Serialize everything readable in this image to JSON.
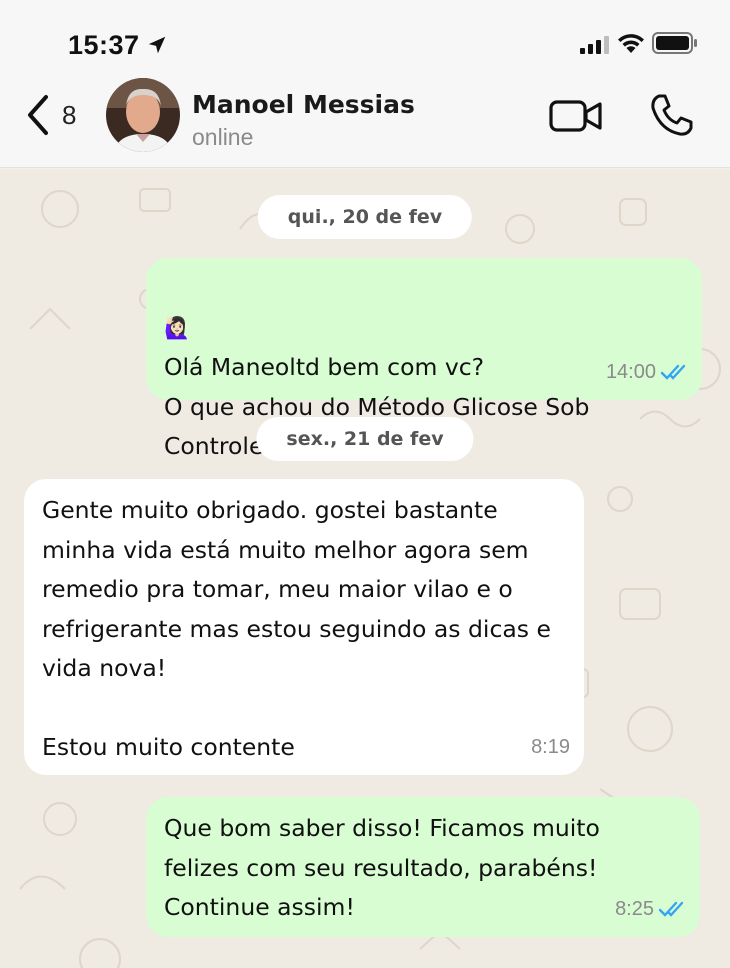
{
  "status_bar": {
    "time": "15:37",
    "icons": [
      "location-arrow-icon",
      "signal-icon",
      "wifi-icon",
      "battery-icon"
    ]
  },
  "header": {
    "back_count": "8",
    "contact_name": "Manoel Messias",
    "contact_status": "online",
    "icons": [
      "chevron-left-icon",
      "video-call-icon",
      "phone-icon"
    ]
  },
  "colors": {
    "outgoing_bubble": "#d9fdd3",
    "incoming_bubble": "#ffffff",
    "read_ticks": "#34a5f0",
    "chat_background": "#efeae2"
  },
  "messages": [
    {
      "type": "date",
      "text": "qui., 20 de fev"
    },
    {
      "type": "outgoing",
      "emoji": "🙋🏻‍♀️",
      "text": "Olá Maneoltd bem com vc?\nO que achou do Método Glicose Sob Controle (MGSC)?",
      "time": "14:00",
      "status": "read"
    },
    {
      "type": "date",
      "text": "sex., 21 de fev"
    },
    {
      "type": "incoming",
      "text": "Gente muito obrigado. gostei bastante minha vida está muito melhor agora sem remedio pra tomar, meu maior vilao e o refrigerante mas estou seguindo as dicas e vida nova!\n\nEstou muito contente",
      "time": "8:19"
    },
    {
      "type": "outgoing",
      "text": "Que bom saber disso! Ficamos muito felizes com seu resultado, parabéns! Continue assim!",
      "time": "8:25",
      "status": "read"
    }
  ]
}
